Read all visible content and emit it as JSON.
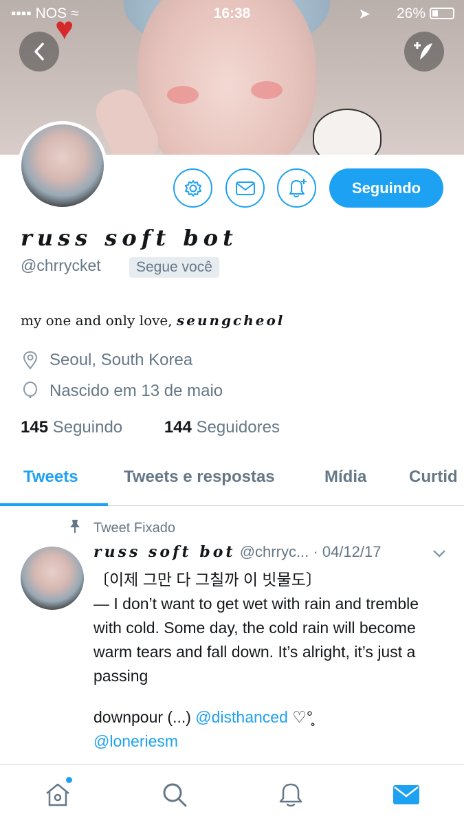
{
  "status_bar": {
    "carrier": "NOS",
    "time": "16:38",
    "battery": "26%"
  },
  "profile": {
    "display_name": "russ soft bot",
    "handle": "@chrrycket",
    "follows_you": "Segue você",
    "bio_prefix": "my one and only love,",
    "bio_fancy": "seungcheol",
    "location": "Seoul, South Korea",
    "birthday": "Nascido em 13 de maio",
    "following_count": "145",
    "following_label": "Seguindo",
    "followers_count": "144",
    "followers_label": "Seguidores",
    "follow_button": "Seguindo"
  },
  "tabs": [
    {
      "label": "Tweets",
      "active": true
    },
    {
      "label": "Tweets e respostas",
      "active": false
    },
    {
      "label": "Mídia",
      "active": false
    },
    {
      "label": "Curtid",
      "active": false
    }
  ],
  "tweet": {
    "pinned_label": "Tweet Fixado",
    "author_name": "russ soft bot",
    "author_handle": "@chrryc...",
    "date": "· 04/12/17",
    "line_korean": "〔이제 그만 다 그칠까 이 빗물도〕",
    "text": "— I don’t want to get wet with rain and tremble  with cold. Some day, the cold rain will become warm tears and fall down. It’s alright, it’s just a passing",
    "text2_prefix": "downpour (...)",
    "mention1": "@disthanced",
    "text2_suffix": "♡°‪̥̥",
    "mention2": "@loneriesm"
  },
  "colors": {
    "accent": "#1da1f2",
    "muted": "#657786",
    "text": "#14171a"
  },
  "icons": {
    "back": "back-icon",
    "compose": "compose-icon",
    "settings": "gear-icon",
    "message": "envelope-icon",
    "notify": "bell-plus-icon",
    "location": "location-pin-icon",
    "birthday": "balloon-icon",
    "pin": "pin-icon",
    "home": "home-icon",
    "search": "search-icon",
    "notifications": "bell-icon",
    "messages": "mail-icon"
  }
}
